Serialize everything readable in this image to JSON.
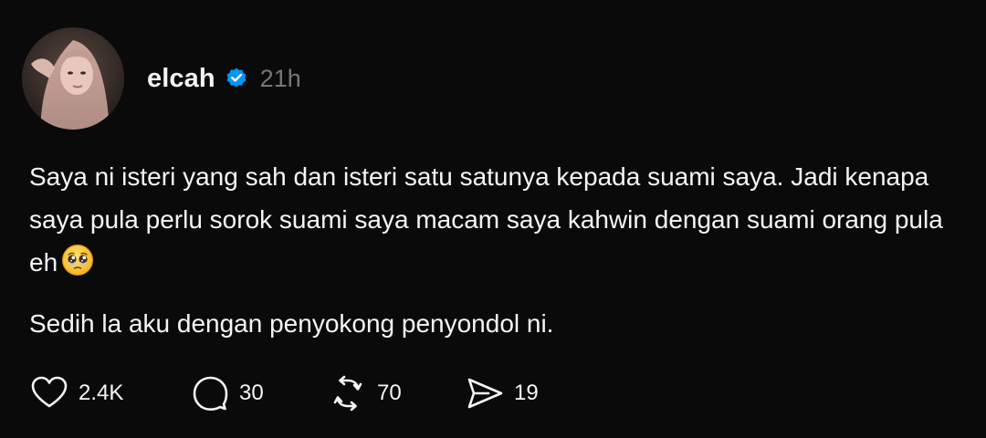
{
  "post": {
    "author": "elcah",
    "verified_icon": "verified-badge-icon",
    "verified_color": "#0095f6",
    "time": "21h",
    "paragraphs": [
      "Saya ni isteri yang sah dan isteri satu satunya kepada suami saya. Jadi kenapa saya pula perlu sorok suami saya macam saya kahwin dengan suami orang pula eh",
      "Sedih la aku dengan penyokong penyondol ni."
    ],
    "emoji": "pleading-face-emoji"
  },
  "actions": {
    "like": {
      "icon": "heart-icon",
      "count": "2.4K"
    },
    "reply": {
      "icon": "comment-icon",
      "count": "30"
    },
    "repost": {
      "icon": "repost-icon",
      "count": "70"
    },
    "share": {
      "icon": "send-icon",
      "count": "19"
    }
  },
  "colors": {
    "background": "#0a0a0a",
    "text": "#f3f5f7",
    "muted": "#777777"
  }
}
